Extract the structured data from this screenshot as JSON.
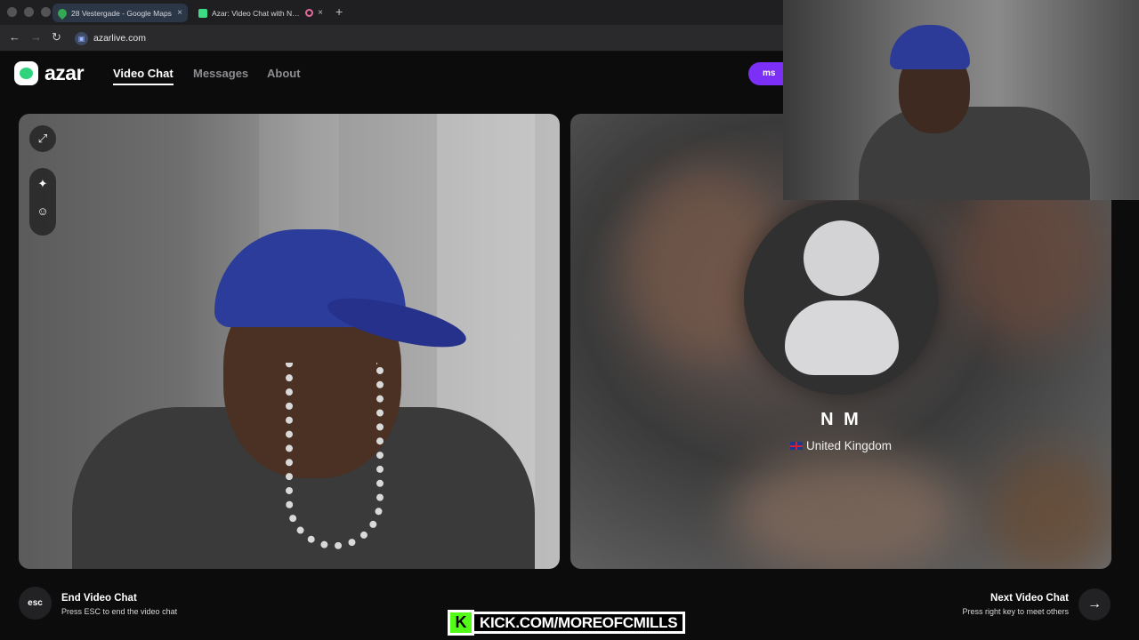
{
  "browser": {
    "tabs": [
      {
        "title": "28 Vestergade - Google Maps",
        "close": "×"
      },
      {
        "title": "Azar: Video Chat with New People",
        "close": "×"
      }
    ],
    "new_tab": "+",
    "address": "azarlive.com",
    "back": "←",
    "forward": "→",
    "reload": "↻"
  },
  "header": {
    "logo": "azar",
    "nav": [
      {
        "label": "Video Chat"
      },
      {
        "label": "Messages"
      },
      {
        "label": "About"
      }
    ],
    "promo_button": "ms"
  },
  "left_panel": {
    "tools": [
      "⤢",
      "✦",
      "☺"
    ]
  },
  "peer": {
    "name": "N M",
    "country": "United Kingdom"
  },
  "controls": {
    "end": {
      "key": "esc",
      "title": "End Video Chat",
      "hint": "Press ESC to end the video chat"
    },
    "next": {
      "title": "Next Video Chat",
      "hint": "Press right key to meet others",
      "icon": "→"
    }
  },
  "overlay": {
    "kick_icon": "K",
    "kick_text": "KICK.COM/MOREOFCMILLS"
  }
}
